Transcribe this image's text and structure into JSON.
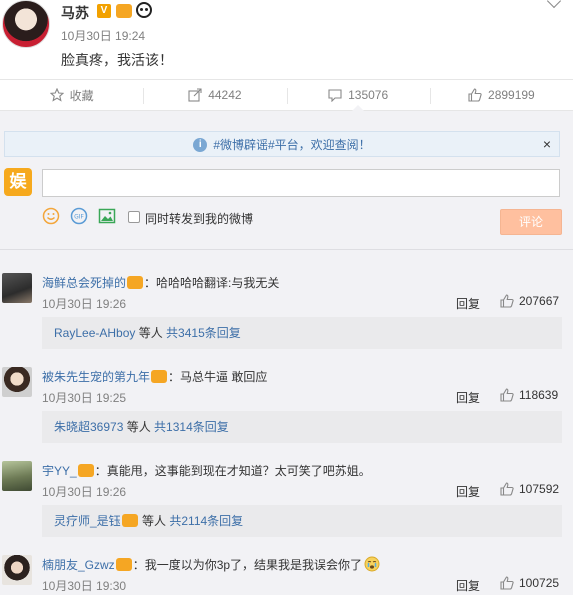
{
  "post": {
    "author": "马苏",
    "verified_mark": "V",
    "time": "10月30日 19:24",
    "text": "脸真疼，我活该！"
  },
  "actions": [
    {
      "icon": "star-icon",
      "label": "收藏"
    },
    {
      "icon": "share-icon",
      "label": "44242"
    },
    {
      "icon": "comment-icon",
      "label": "135076"
    },
    {
      "icon": "like-icon",
      "label": "2899199"
    }
  ],
  "notice": {
    "hashtag": "#微博辟谣#平台，",
    "welcome": "欢迎查阅！",
    "close": "×"
  },
  "composer": {
    "avatar_text": "娱",
    "input_value": "",
    "repost_label": "同时转发到我的微博",
    "submit_label": "评论"
  },
  "comments": [
    {
      "user": "海鲜总会死掉的",
      "text": "：哈哈哈哈翻译:与我无关",
      "time": "10月30日 19:26",
      "reply": "回复",
      "likes": "207667",
      "sub_user": "RayLee-AHboy",
      "sub_mid": " 等人 ",
      "sub_total": "共3415条回复"
    },
    {
      "user": "被朱先生宠的第九年",
      "text": "：马总牛逼 敢回应",
      "time": "10月30日 19:25",
      "reply": "回复",
      "likes": "118639",
      "sub_user": "朱晓超36973",
      "sub_mid": " 等人 ",
      "sub_total": "共1314条回复"
    },
    {
      "user": "宇YY_",
      "text": "：真能甩，这事能到现在才知道？太可笑了吧苏姐。",
      "time": "10月30日 19:26",
      "reply": "回复",
      "likes": "107592",
      "sub_user": "灵疗师_是钰",
      "sub_mid": " 等人 ",
      "sub_total": "共2114条回复"
    },
    {
      "user": "楠朋友_Gzwz",
      "text": "：我一度以为你3p了，结果我是我误会你了",
      "time": "10月30日 19:30",
      "reply": "回复",
      "likes": "100725"
    }
  ]
}
